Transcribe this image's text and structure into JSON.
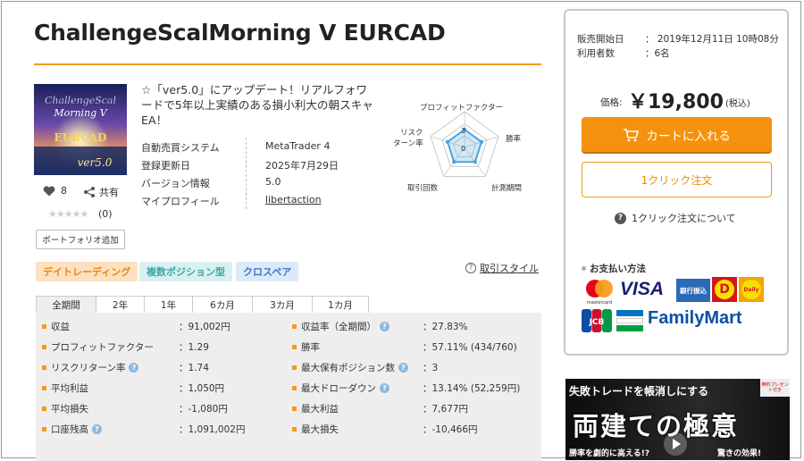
{
  "product": {
    "title": "ChallengeScalMorning V EURCAD",
    "thumbnail": {
      "line1": "ChallengeScal",
      "line2": "Morning V",
      "line3": "EURCAD",
      "line4": "ver5.0"
    },
    "description": "☆「ver5.0」にアップデート！リアルフォワードで5年以上実績のある損小利大の朝スキャEA！",
    "specs": [
      {
        "label": "自動売買システム",
        "value": "MetaTrader 4"
      },
      {
        "label": "登録更新日",
        "value": "2025年7月29日"
      },
      {
        "label": "バージョン情報",
        "value": "5.0"
      },
      {
        "label": "マイプロフィール",
        "value": "libertaction"
      }
    ],
    "likes": "8",
    "share_label": "共有",
    "stars": "★★★★★",
    "review_count": "(0)",
    "portfolio_button": "ポートフォリオ追加"
  },
  "radar": {
    "labels": {
      "profit_factor": "プロフィットファクター",
      "win_rate": "勝率",
      "period": "計測期間",
      "trades": "取引回数",
      "risk_return_1": "リスク",
      "risk_return_2": "ターン率"
    },
    "tick_3": "3",
    "tick_0": "0",
    "values": {
      "profit_factor": 0.5,
      "win_rate": 0.5,
      "period": 0.5,
      "trades": 0.5,
      "risk_return": 0.5
    }
  },
  "tags": [
    "デイトレーディング",
    "複数ポジション型",
    "クロスペア"
  ],
  "style_link": "取引スタイル",
  "tabs": [
    "全期間",
    "2年",
    "1年",
    "6カ月",
    "3カ月",
    "1カ月"
  ],
  "stats_left": [
    {
      "label": "収益",
      "value": "：91,002円",
      "help": false
    },
    {
      "label": "プロフィットファクター",
      "value": "：1.29",
      "help": false
    },
    {
      "label": "リスクリターン率",
      "value": "：1.74",
      "help": true
    },
    {
      "label": "平均利益",
      "value": "：1,050円",
      "help": false
    },
    {
      "label": "平均損失",
      "value": "：-1,080円",
      "help": false
    },
    {
      "label": "口座残高",
      "value": "：1,091,002円",
      "help": true
    }
  ],
  "stats_right": [
    {
      "label": "収益率（全期間）",
      "value": "：27.83%",
      "help": true
    },
    {
      "label": "勝率",
      "value": "：57.11% (434/760)",
      "help": false
    },
    {
      "label": "最大保有ポジション数",
      "value": "：3",
      "help": true
    },
    {
      "label": "最大ドローダウン",
      "value": "：13.14% (52,259円)",
      "help": true
    },
    {
      "label": "最大利益",
      "value": "：7,677円",
      "help": false
    },
    {
      "label": "最大損失",
      "value": "：-10,466円",
      "help": false
    }
  ],
  "sidebar": {
    "sale_start_label": "販売開始日",
    "sale_start_value": "：  2019年12月11日 10時08分",
    "users_label": "利用者数",
    "users_value": "：6名",
    "price_label": "価格:",
    "price": "￥19,800",
    "tax": "(税込)",
    "cart_button": "カートに入れる",
    "one_click_button": "1クリック注文",
    "one_click_help": "1クリック注文について",
    "payment_title": "お支払い方法",
    "payments": {
      "mastercard": "mastercard",
      "visa": "VISA",
      "bank": "銀行振込",
      "daily": "Daily",
      "jcb": "JCB",
      "familymart": "FamilyMart"
    }
  },
  "banner": {
    "line1": "失敗トレードを帳消しにする",
    "big": "両建ての極意",
    "badge": "無料プレゼント付き",
    "sub1": "勝率を劇的に高える!?",
    "sub2": "驚きの効果!"
  },
  "colors": {
    "accent": "#f39a1e",
    "cart": "#f4920f",
    "radar": "#4aa3df"
  }
}
